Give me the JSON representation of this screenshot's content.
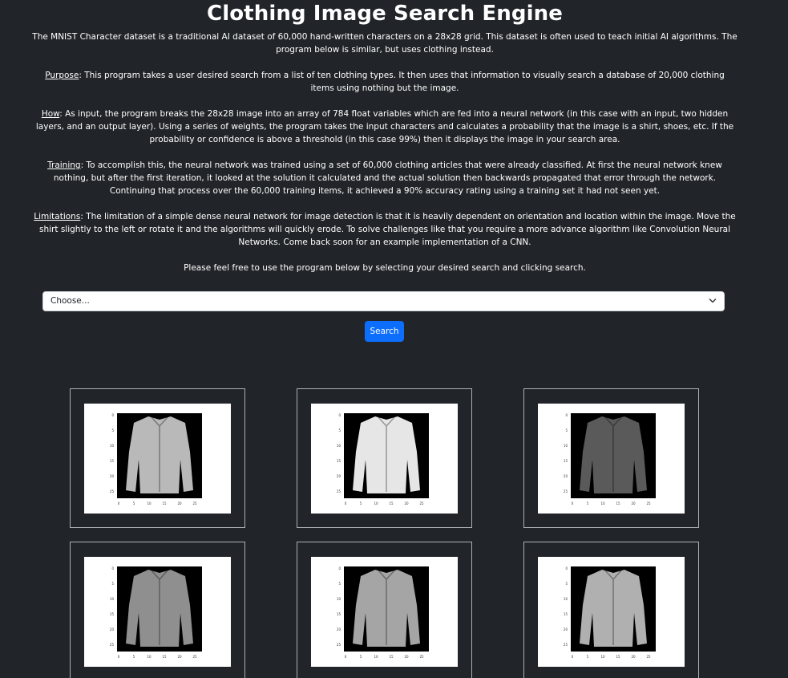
{
  "title": "Clothing Image Search Engine",
  "intro": {
    "p1": "The MNIST Character dataset is a traditional AI dataset of 60,000 hand-written characters on a 28x28 grid. This dataset is often used to teach initial AI algorithms. The program below is similar, but uses clothing instead.",
    "purpose_label": "Purpose",
    "purpose_text": ": This program takes a user desired search from a list of ten clothing types. It then uses that information to visually search a database of 20,000 clothing items using nothing but the image.",
    "how_label": "How",
    "how_text": ": As input, the program breaks the 28x28 image into an array of 784 float variables which are fed into a neural network (in this case with an input, two hidden layers, and an output layer). Using a series of weights, the program takes the input characters and calculates a probability that the image is a shirt, shoes, etc. If the probability or confidence is above a threshold (in this case 99%) then it displays the image in your search area.",
    "training_label": "Training",
    "training_text": ": To accomplish this, the neural network was trained using a set of 60,000 clothing articles that were already classified. At first the neural network knew nothing, but after the first iteration, it looked at the solution it calculated and the actual solution then backwards propagated that error through the network. Continuing that process over the 60,000 training items, it achieved a 90% accuracy rating using a training set it had not seen yet.",
    "limitations_label": "Limitations",
    "limitations_text": ": The limitation of a simple dense neural network for image detection is that it is heavily dependent on orientation and location within the image. Move the shirt slightly to the left or rotate it and the algorithms will quickly erode. To solve challenges like that you require a more advance algorithm like Convolution Neural Networks. Come back soon for an example implementation of a CNN.",
    "cta": "Please feel free to use the program below by selecting your desired search and clicking search."
  },
  "search": {
    "selected": "Choose...",
    "button_label": "Search"
  },
  "results": {
    "tick_labels_y": [
      "0",
      "5",
      "10",
      "15",
      "20",
      "25"
    ],
    "tick_labels_x": [
      "0",
      "5",
      "10",
      "15",
      "20",
      "25"
    ],
    "items": [
      {
        "shade": "#b9b9b9"
      },
      {
        "shade": "#e6e6e6"
      },
      {
        "shade": "#5a5a5a"
      },
      {
        "shade": "#8f8f8f"
      },
      {
        "shade": "#a5a5a5"
      },
      {
        "shade": "#b0b0b0"
      }
    ]
  }
}
